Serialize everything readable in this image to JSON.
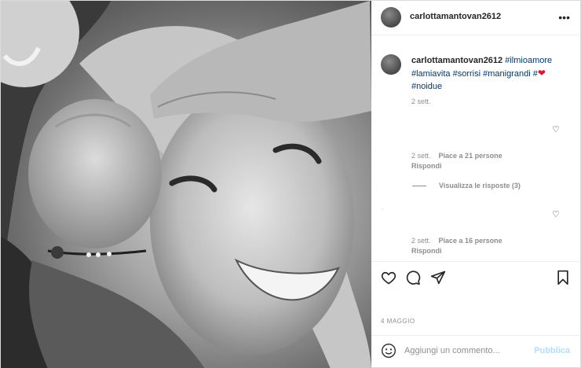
{
  "header": {
    "username": "carlottamantovan2612",
    "more_icon": "•••"
  },
  "caption": {
    "username": "carlottamantovan2612",
    "tags_line1": [
      " #ilmioamore"
    ],
    "tags_line2": [
      "#lamiavita",
      " #sorrisi",
      " #manigrandi",
      " #"
    ],
    "tag_last": "#noidue",
    "heart": "❤",
    "time": "2 sett."
  },
  "comment1": {
    "time": "2 sett.",
    "likes": "Piace a 21 persone",
    "reply": "Rispondi",
    "view_replies": "Visualizza le risposte (3)"
  },
  "comment2": {
    "time": "2 sett.",
    "likes": "Piace a 16 persone",
    "reply": "Rispondi"
  },
  "post_date": "4 MAGGIO",
  "add_comment": {
    "placeholder": "Aggiungi un commento...",
    "publish": "Pubblica"
  },
  "icons": [
    "heart-icon",
    "comment-icon",
    "share-icon",
    "bookmark-icon",
    "emoji-icon",
    "more-icon"
  ],
  "colors": {
    "link": "#00376b",
    "heart": "#e0152c",
    "publish": "#b2dffc",
    "muted": "#8e8e8e"
  }
}
